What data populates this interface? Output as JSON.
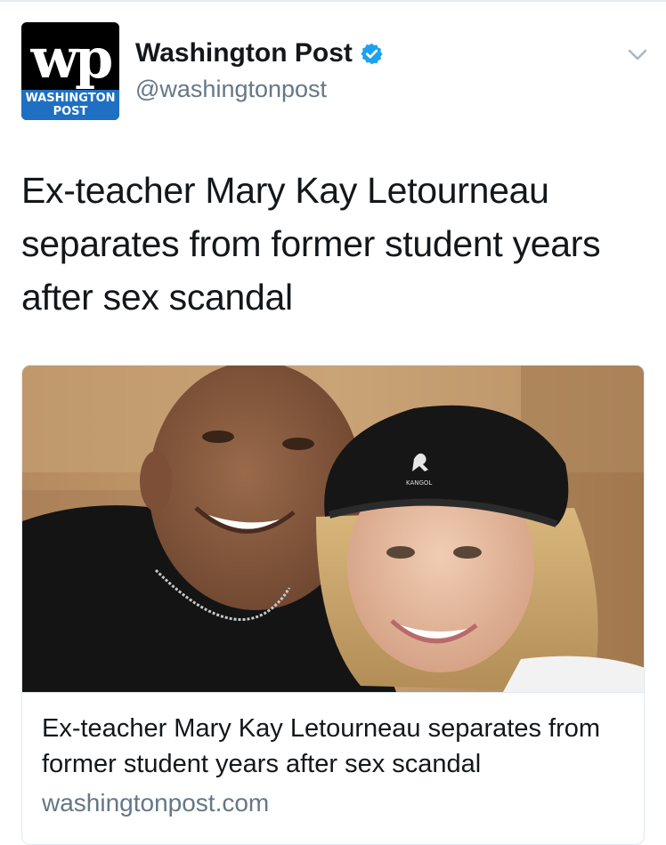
{
  "account": {
    "avatar_mark": "wp",
    "avatar_label_line1": "WASHINGTON",
    "avatar_label_line2": "POST",
    "display_name": "Washington Post",
    "handle": "@washingtonpost",
    "verified_icon": "verified-badge-icon",
    "menu_icon": "chevron-down-icon"
  },
  "tweet": {
    "text": "Ex-teacher Mary Kay Letourneau separates from former student years after sex scandal"
  },
  "card": {
    "image_description_icon": "photo",
    "hat_brand": "KANGOL",
    "title": "Ex-teacher Mary Kay Letourneau separates from former student years after sex scandal",
    "domain": "washingtonpost.com"
  },
  "colors": {
    "verified_blue": "#1da1f2",
    "secondary_text": "#657786",
    "primary_text": "#14171a",
    "avatar_blue": "#1f6fc2"
  }
}
